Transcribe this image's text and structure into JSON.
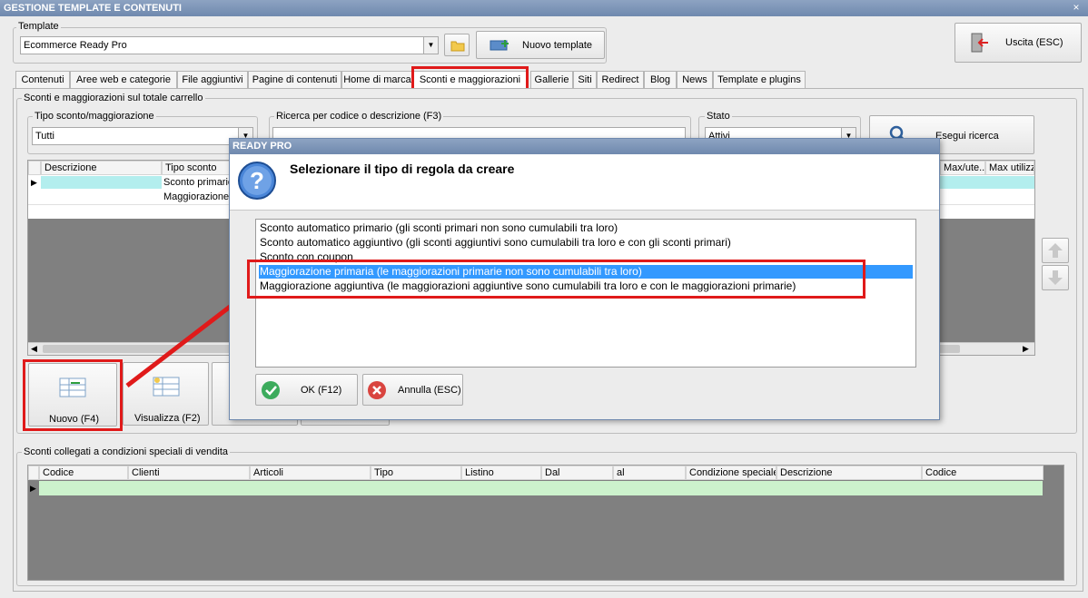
{
  "window": {
    "title": "GESTIONE TEMPLATE E CONTENUTI",
    "close": "×"
  },
  "template": {
    "group_label": "Template",
    "selected": "Ecommerce Ready Pro",
    "new_button": "Nuovo template",
    "exit_button": "Uscita (ESC)"
  },
  "tabs": [
    "Contenuti",
    "Aree web e categorie",
    "File aggiuntivi",
    "Pagine di contenuti",
    "Home di marca",
    "Sconti e maggiorazioni",
    "Gallerie",
    "Siti",
    "Redirect",
    "Blog",
    "News",
    "Template e plugins"
  ],
  "cart_section": {
    "label": "Sconti e maggiorazioni sul totale carrello",
    "type_label": "Tipo sconto/maggiorazione",
    "type_value": "Tutti",
    "search_label": "Ricerca per codice o descrizione (F3)",
    "search_value": "",
    "state_label": "Stato",
    "state_value": "Attivi",
    "search_button": "Esegui ricerca",
    "columns": [
      "Descrizione",
      "Tipo sconto",
      "Max/ute...",
      "Max utilizzi"
    ],
    "rows": [
      "Sconto primario",
      "Maggiorazione"
    ],
    "new_button": "Nuovo (F4)",
    "view_button": "Visualizza (F2)"
  },
  "special_section": {
    "label": "Sconti collegati a condizioni speciali di vendita",
    "columns": [
      "Codice",
      "Clienti",
      "Articoli",
      "Tipo",
      "Listino",
      "Dal",
      "al",
      "Condizione speciale",
      "Descrizione",
      "Codice"
    ]
  },
  "dialog": {
    "title": "READY PRO",
    "heading": "Selezionare il tipo di regola da creare",
    "options": [
      "Sconto automatico primario (gli sconti primari non sono cumulabili tra loro)",
      "Sconto automatico aggiuntivo (gli sconti aggiuntivi sono cumulabili tra loro e con gli sconti primari)",
      "Sconto con coupon",
      "Maggiorazione primaria (le maggiorazioni primarie non sono cumulabili tra loro)",
      "Maggiorazione aggiuntiva (le maggiorazioni aggiuntive sono cumulabili tra loro e con le maggiorazioni primarie)"
    ],
    "selected_index": 3,
    "ok_button": "OK (F12)",
    "cancel_button": "Annulla (ESC)"
  },
  "colors": {
    "highlight": "#E01A1A",
    "selection": "#3399FF",
    "row_highlight": "#B3EEEE",
    "row_green": "#CCF2CC"
  },
  "icons": [
    "folder-icon",
    "new-template-icon",
    "exit-door-icon",
    "search-magnifier-icon",
    "new-rule-icon",
    "view-icon",
    "up-arrow-icon",
    "down-arrow-icon",
    "question-icon",
    "check-icon",
    "cancel-x-icon",
    "row-pointer-icon"
  ]
}
